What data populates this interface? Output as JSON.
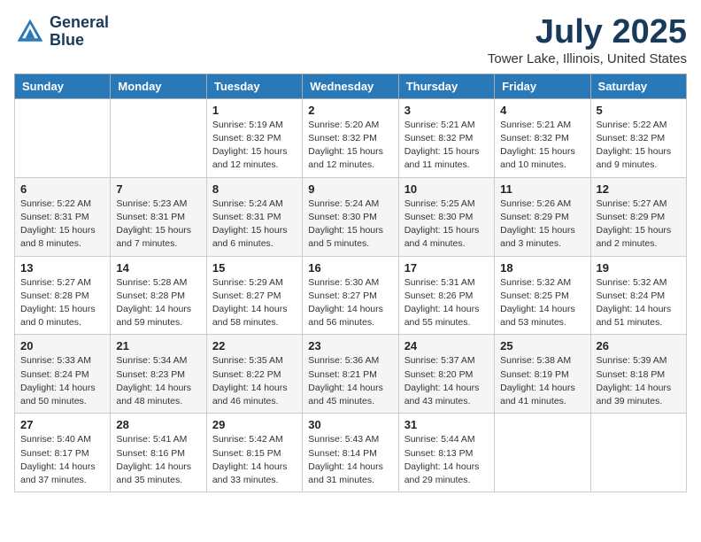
{
  "header": {
    "logo_line1": "General",
    "logo_line2": "Blue",
    "month": "July 2025",
    "location": "Tower Lake, Illinois, United States"
  },
  "weekdays": [
    "Sunday",
    "Monday",
    "Tuesday",
    "Wednesday",
    "Thursday",
    "Friday",
    "Saturday"
  ],
  "weeks": [
    [
      {
        "day": "",
        "info": ""
      },
      {
        "day": "",
        "info": ""
      },
      {
        "day": "1",
        "info": "Sunrise: 5:19 AM\nSunset: 8:32 PM\nDaylight: 15 hours and 12 minutes."
      },
      {
        "day": "2",
        "info": "Sunrise: 5:20 AM\nSunset: 8:32 PM\nDaylight: 15 hours and 12 minutes."
      },
      {
        "day": "3",
        "info": "Sunrise: 5:21 AM\nSunset: 8:32 PM\nDaylight: 15 hours and 11 minutes."
      },
      {
        "day": "4",
        "info": "Sunrise: 5:21 AM\nSunset: 8:32 PM\nDaylight: 15 hours and 10 minutes."
      },
      {
        "day": "5",
        "info": "Sunrise: 5:22 AM\nSunset: 8:32 PM\nDaylight: 15 hours and 9 minutes."
      }
    ],
    [
      {
        "day": "6",
        "info": "Sunrise: 5:22 AM\nSunset: 8:31 PM\nDaylight: 15 hours and 8 minutes."
      },
      {
        "day": "7",
        "info": "Sunrise: 5:23 AM\nSunset: 8:31 PM\nDaylight: 15 hours and 7 minutes."
      },
      {
        "day": "8",
        "info": "Sunrise: 5:24 AM\nSunset: 8:31 PM\nDaylight: 15 hours and 6 minutes."
      },
      {
        "day": "9",
        "info": "Sunrise: 5:24 AM\nSunset: 8:30 PM\nDaylight: 15 hours and 5 minutes."
      },
      {
        "day": "10",
        "info": "Sunrise: 5:25 AM\nSunset: 8:30 PM\nDaylight: 15 hours and 4 minutes."
      },
      {
        "day": "11",
        "info": "Sunrise: 5:26 AM\nSunset: 8:29 PM\nDaylight: 15 hours and 3 minutes."
      },
      {
        "day": "12",
        "info": "Sunrise: 5:27 AM\nSunset: 8:29 PM\nDaylight: 15 hours and 2 minutes."
      }
    ],
    [
      {
        "day": "13",
        "info": "Sunrise: 5:27 AM\nSunset: 8:28 PM\nDaylight: 15 hours and 0 minutes."
      },
      {
        "day": "14",
        "info": "Sunrise: 5:28 AM\nSunset: 8:28 PM\nDaylight: 14 hours and 59 minutes."
      },
      {
        "day": "15",
        "info": "Sunrise: 5:29 AM\nSunset: 8:27 PM\nDaylight: 14 hours and 58 minutes."
      },
      {
        "day": "16",
        "info": "Sunrise: 5:30 AM\nSunset: 8:27 PM\nDaylight: 14 hours and 56 minutes."
      },
      {
        "day": "17",
        "info": "Sunrise: 5:31 AM\nSunset: 8:26 PM\nDaylight: 14 hours and 55 minutes."
      },
      {
        "day": "18",
        "info": "Sunrise: 5:32 AM\nSunset: 8:25 PM\nDaylight: 14 hours and 53 minutes."
      },
      {
        "day": "19",
        "info": "Sunrise: 5:32 AM\nSunset: 8:24 PM\nDaylight: 14 hours and 51 minutes."
      }
    ],
    [
      {
        "day": "20",
        "info": "Sunrise: 5:33 AM\nSunset: 8:24 PM\nDaylight: 14 hours and 50 minutes."
      },
      {
        "day": "21",
        "info": "Sunrise: 5:34 AM\nSunset: 8:23 PM\nDaylight: 14 hours and 48 minutes."
      },
      {
        "day": "22",
        "info": "Sunrise: 5:35 AM\nSunset: 8:22 PM\nDaylight: 14 hours and 46 minutes."
      },
      {
        "day": "23",
        "info": "Sunrise: 5:36 AM\nSunset: 8:21 PM\nDaylight: 14 hours and 45 minutes."
      },
      {
        "day": "24",
        "info": "Sunrise: 5:37 AM\nSunset: 8:20 PM\nDaylight: 14 hours and 43 minutes."
      },
      {
        "day": "25",
        "info": "Sunrise: 5:38 AM\nSunset: 8:19 PM\nDaylight: 14 hours and 41 minutes."
      },
      {
        "day": "26",
        "info": "Sunrise: 5:39 AM\nSunset: 8:18 PM\nDaylight: 14 hours and 39 minutes."
      }
    ],
    [
      {
        "day": "27",
        "info": "Sunrise: 5:40 AM\nSunset: 8:17 PM\nDaylight: 14 hours and 37 minutes."
      },
      {
        "day": "28",
        "info": "Sunrise: 5:41 AM\nSunset: 8:16 PM\nDaylight: 14 hours and 35 minutes."
      },
      {
        "day": "29",
        "info": "Sunrise: 5:42 AM\nSunset: 8:15 PM\nDaylight: 14 hours and 33 minutes."
      },
      {
        "day": "30",
        "info": "Sunrise: 5:43 AM\nSunset: 8:14 PM\nDaylight: 14 hours and 31 minutes."
      },
      {
        "day": "31",
        "info": "Sunrise: 5:44 AM\nSunset: 8:13 PM\nDaylight: 14 hours and 29 minutes."
      },
      {
        "day": "",
        "info": ""
      },
      {
        "day": "",
        "info": ""
      }
    ]
  ]
}
